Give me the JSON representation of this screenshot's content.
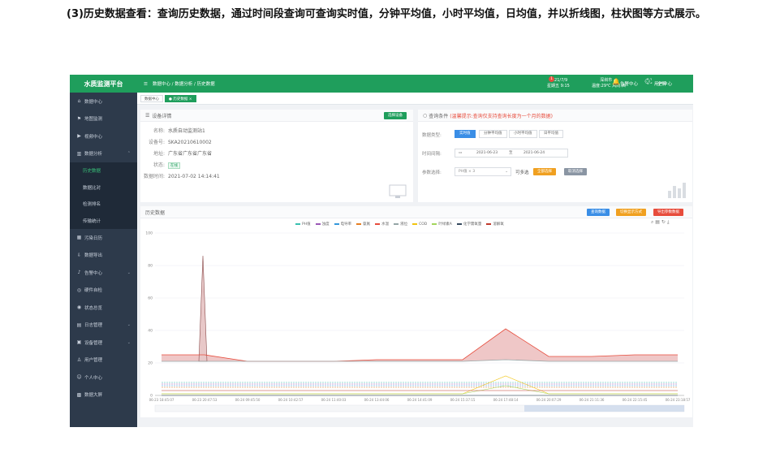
{
  "caption": "(3)历史数据查看：查询历史数据，通过时间段查询可查询实时值，分钟平均值，小时平均值，日均值，并以折线图，柱状图等方式展示。",
  "colors": {
    "brand": "#1f9e5c",
    "sidebar": "#2d3a4b",
    "active_sub": "#39c37a",
    "query_blue": "#3a8ee6",
    "orange": "#f0a020",
    "red": "#e74c3c"
  },
  "sidebar": {
    "title": "水质监测平台",
    "items": [
      {
        "label": "数据中心",
        "icon": "home-icon"
      },
      {
        "label": "地图监测",
        "icon": "map-icon"
      },
      {
        "label": "视频中心",
        "icon": "video-icon"
      },
      {
        "label": "数据分析",
        "icon": "chart-icon",
        "expanded": true
      }
    ],
    "subitems": [
      {
        "label": "历史数据",
        "active": true
      },
      {
        "label": "数据比对"
      },
      {
        "label": "检测排名"
      },
      {
        "label": "传输统计"
      }
    ],
    "items2": [
      {
        "label": "污染日历",
        "icon": "calendar-icon"
      },
      {
        "label": "数据导出",
        "icon": "export-icon"
      },
      {
        "label": "告警中心",
        "icon": "bell-icon",
        "arrow": true
      },
      {
        "label": "硬件自检",
        "icon": "check-icon"
      },
      {
        "label": "状态总览",
        "icon": "status-icon"
      },
      {
        "label": "日志管理",
        "icon": "log-icon",
        "arrow": true
      },
      {
        "label": "设备管理",
        "icon": "device-icon",
        "arrow": true
      },
      {
        "label": "用户管理",
        "icon": "user-icon"
      },
      {
        "label": "个人中心",
        "icon": "person-icon"
      },
      {
        "label": "数据大屏",
        "icon": "screen-icon"
      }
    ]
  },
  "topbar": {
    "breadcrumb": "数据中心 / 数据分析 / 历史数据",
    "date": "2021/7/9",
    "weekday_time": "星期五 9:15",
    "city": "深圳市",
    "weather": "温度:29℃ 风向:西",
    "fullscreen": "全屏",
    "alarm_center": "告警中心",
    "alarm_count": "1",
    "user_center": "用户中心"
  },
  "tabs": {
    "home": "数据中心",
    "current": "历史数据 ×"
  },
  "device": {
    "head": "设备详情",
    "select_btn": "选择设备",
    "name_label": "名称:",
    "name": "水质自动监测站1",
    "id_label": "设备号:",
    "id": "SKA20210610002",
    "addr_label": "地址:",
    "addr": "广东省广东省广东省",
    "status_label": "状态:",
    "status": "在线",
    "time_label": "数据时间:",
    "time": "2021-07-02 14:14:41"
  },
  "query": {
    "head": "查询条件",
    "hint": "(温馨提示:查询仅支持查询长度为一个月的数据)",
    "type_label": "数据类型:",
    "types": [
      "实时值",
      "分钟平均值",
      "小时平均值",
      "日平均值"
    ],
    "range_label": "时间间隔:",
    "start": "2021-06-23",
    "to": "至",
    "end": "2021-06-24",
    "param_label": "参数选择:",
    "param_value": "PH值  × 3",
    "multi": "可多选",
    "btn_select": "全部选择",
    "btn_clear": "取消选择"
  },
  "history": {
    "head": "历史数据",
    "btn_query": "查询数据",
    "btn_toggle": "切换显示方式",
    "btn_export": "导出参数数据"
  },
  "chart_data": {
    "type": "line",
    "ylim": [
      0,
      100
    ],
    "yticks": [
      0,
      20,
      40,
      60,
      80,
      100
    ],
    "x_ticks": [
      "06-23 18:45:07",
      "06-23 20:47:53",
      "06-24 09:45:50",
      "06-24 10:42:57",
      "06-24 11:40:03",
      "06-24 13:44:06",
      "06-24 14:41:09",
      "06-24 15:37:15",
      "06-24 17:48:14",
      "06-24 20:07:29",
      "06-24 21:11:36",
      "06-24 22:15:45",
      "06-24 23:18:57"
    ],
    "series": [
      {
        "name": "PH值",
        "color": "#39c0b0",
        "values": [
          8,
          8,
          8,
          8,
          8,
          8,
          8,
          8,
          8,
          8,
          8,
          8,
          8
        ]
      },
      {
        "name": "浊度",
        "color": "#9b59b6",
        "values": [
          7,
          7,
          7,
          7,
          7,
          7,
          7,
          7,
          7,
          7,
          7,
          7,
          7
        ]
      },
      {
        "name": "电导率",
        "color": "#3498db",
        "values": [
          6,
          6,
          6,
          6,
          6,
          6,
          6,
          6,
          6,
          6,
          6,
          6,
          6
        ]
      },
      {
        "name": "氨氮",
        "color": "#e67e22",
        "values": [
          5,
          5,
          5,
          5,
          5,
          5,
          5,
          5,
          5,
          5,
          5,
          5,
          5
        ]
      },
      {
        "name": "水温",
        "color": "#e74c3c",
        "values": [
          25,
          25,
          21,
          21,
          21,
          22,
          22,
          22,
          41,
          24,
          24,
          25,
          25
        ]
      },
      {
        "name": "液位",
        "color": "#95a5a6",
        "values": [
          21,
          21,
          21,
          21,
          21,
          21,
          21,
          21,
          22,
          21,
          21,
          21,
          21
        ]
      },
      {
        "name": "COD",
        "color": "#f1c40f",
        "values": [
          1,
          1,
          1,
          1,
          1,
          1,
          1,
          1,
          12,
          1,
          1,
          1,
          1
        ]
      },
      {
        "name": "叶绿素A",
        "color": "#a3d55c",
        "values": [
          1,
          1,
          1,
          1,
          1,
          1,
          1,
          1,
          6,
          1,
          1,
          1,
          1
        ]
      },
      {
        "name": "化学需氧量",
        "color": "#34495e",
        "values": [
          0,
          0,
          0,
          0,
          0,
          0,
          0,
          0,
          0,
          0,
          0,
          0,
          0
        ]
      },
      {
        "name": "溶解氧",
        "color": "#c0392b",
        "values": [
          3,
          3,
          3,
          3,
          3,
          3,
          3,
          3,
          3,
          3,
          3,
          3,
          3
        ]
      }
    ],
    "spike": {
      "x_index": 1,
      "value": 86
    }
  }
}
